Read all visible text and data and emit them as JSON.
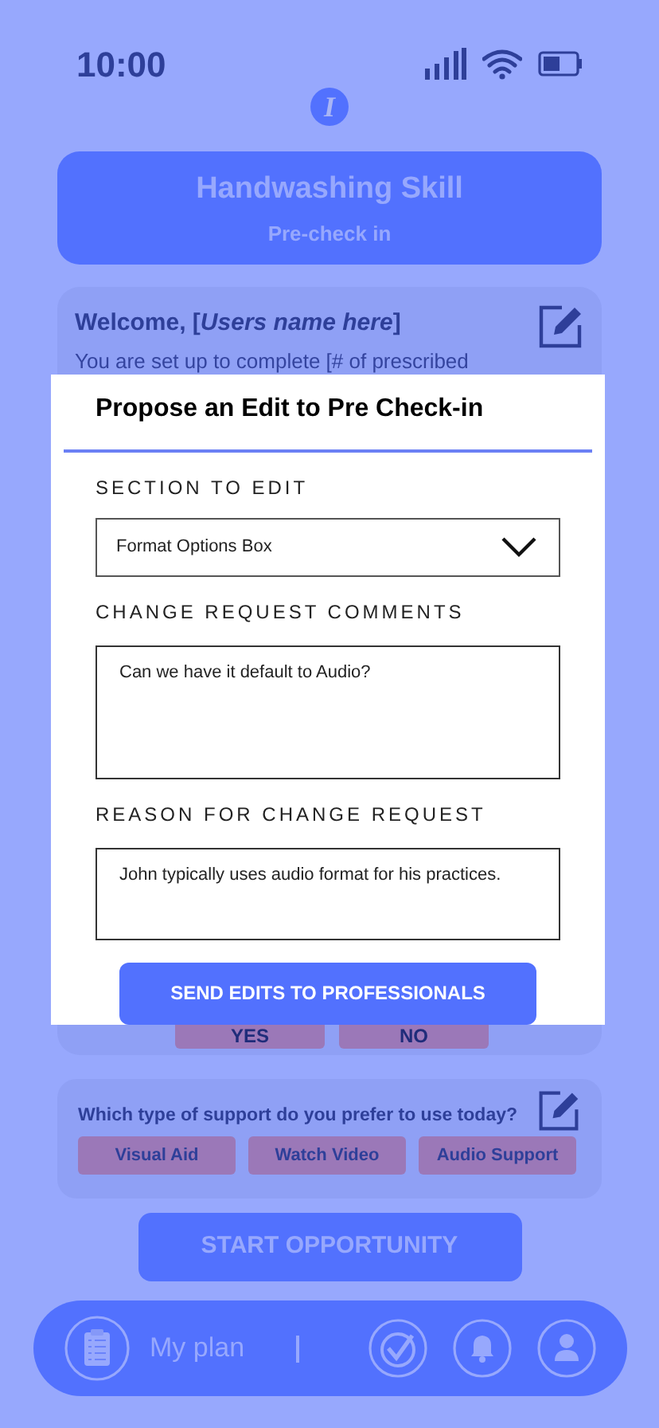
{
  "status_bar": {
    "time": "10:00"
  },
  "logo": "I",
  "header": {
    "title": "Handwashing Skill",
    "subtitle": "Pre-check in"
  },
  "welcome_card": {
    "greeting": "Welcome, [*Users name here*]",
    "text": "You are set up to complete [# of prescribed",
    "buttons": [
      "YES",
      "NO"
    ]
  },
  "support_card": {
    "question": "Which type of support do you prefer to use today?",
    "options": [
      "Visual Aid",
      "Watch Video",
      "Audio Support"
    ]
  },
  "start_button": "START OPPORTUNITY",
  "nav_bar": {
    "plan_label": "My plan"
  },
  "modal": {
    "title": "Propose an Edit to Pre Check-in",
    "section_label": "SECTION TO EDIT",
    "section_value": "Format Options Box",
    "comments_label": "CHANGE REQUEST COMMENTS",
    "comments_value": "Can we have it default to Audio?",
    "reason_label": "REASON FOR CHANGE REQUEST",
    "reason_value": "John typically uses audio format for his practices.",
    "submit": "SEND EDITS TO PROFESSIONALS"
  }
}
